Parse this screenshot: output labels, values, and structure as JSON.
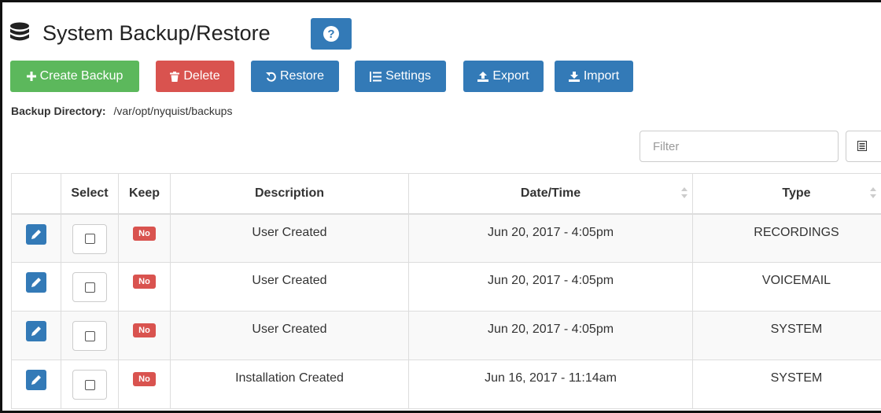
{
  "page": {
    "title": "System Backup/Restore",
    "icons": {
      "header": "database-icon",
      "help": "question-circle-icon"
    }
  },
  "toolbar": {
    "create_label": "Create Backup",
    "delete_label": "Delete",
    "restore_label": "Restore",
    "settings_label": "Settings",
    "export_label": "Export",
    "import_label": "Import",
    "icons": {
      "create": "plus-icon",
      "delete": "trash-icon",
      "restore": "undo-icon",
      "settings": "list-icon",
      "export": "upload-icon",
      "import": "download-icon"
    }
  },
  "directory": {
    "label": "Backup Directory:",
    "value": "/var/opt/nyquist/backups"
  },
  "filter": {
    "placeholder": "Filter",
    "columns_icon": "columns-list-icon"
  },
  "table": {
    "headers": {
      "select": "Select",
      "keep": "Keep",
      "description": "Description",
      "datetime": "Date/Time",
      "type": "Type"
    },
    "rows": [
      {
        "keep": "No",
        "description": "User Created",
        "datetime": "Jun 20, 2017 - 4:05pm",
        "type": "RECORDINGS"
      },
      {
        "keep": "No",
        "description": "User Created",
        "datetime": "Jun 20, 2017 - 4:05pm",
        "type": "VOICEMAIL"
      },
      {
        "keep": "No",
        "description": "User Created",
        "datetime": "Jun 20, 2017 - 4:05pm",
        "type": "SYSTEM"
      },
      {
        "keep": "No",
        "description": "Installation Created",
        "datetime": "Jun 16, 2017 - 11:14am",
        "type": "SYSTEM"
      }
    ]
  },
  "colors": {
    "primary": "#337ab7",
    "success": "#5cb85c",
    "danger": "#d9534f"
  }
}
